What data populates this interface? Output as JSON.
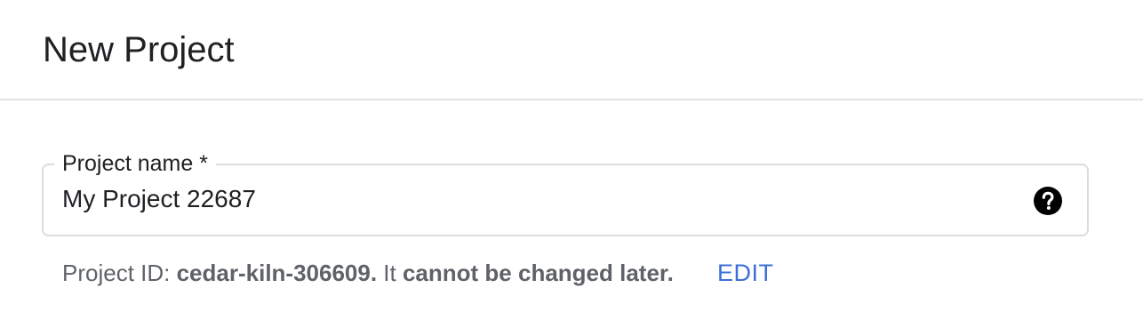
{
  "dialog": {
    "title": "New Project"
  },
  "project_name_field": {
    "label": "Project name *",
    "value": "My Project 22687",
    "help_icon": "help-circle-icon"
  },
  "project_id_hint": {
    "prefix": "Project ID: ",
    "project_id": "cedar-kiln-306609.",
    "middle": " It ",
    "emphasis": "cannot be changed later.",
    "edit_label": "EDIT"
  },
  "colors": {
    "text_primary": "#202124",
    "text_secondary": "#5f6368",
    "link": "#3c6fd6",
    "border": "#dadce0",
    "divider": "#e3e3e3"
  }
}
